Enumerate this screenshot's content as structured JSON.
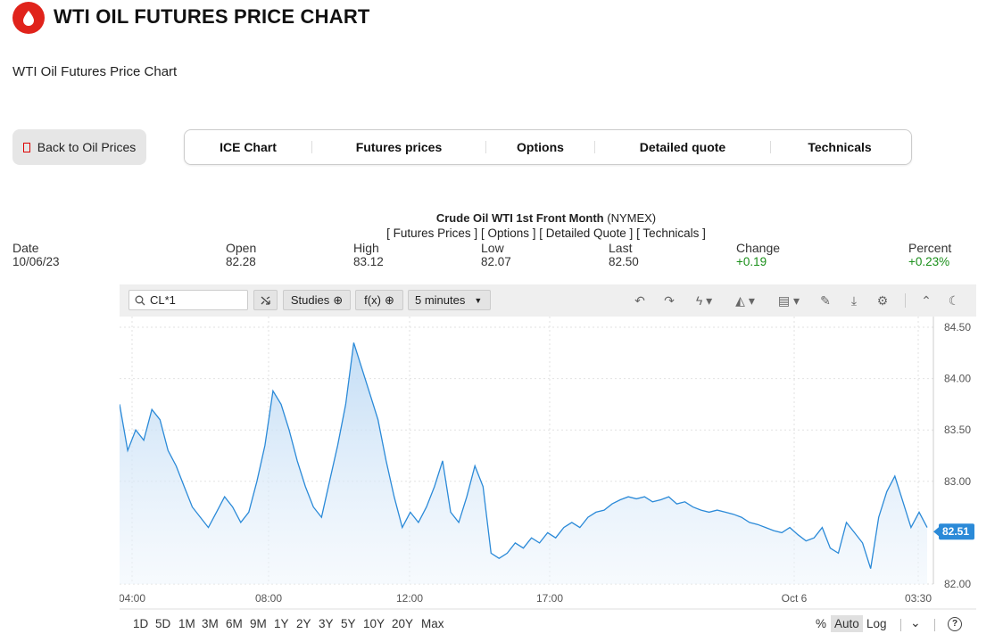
{
  "header": {
    "title": "WTI OIL FUTURES PRICE CHART",
    "subtitle": "WTI Oil Futures Price Chart",
    "logo_icon": "oil-drop-icon",
    "brand_color": "#e0231b"
  },
  "back_button": {
    "label": "Back to Oil Prices"
  },
  "tabs": [
    {
      "label": "ICE Chart"
    },
    {
      "label": "Futures prices"
    },
    {
      "label": "Options"
    },
    {
      "label": "Detailed quote"
    },
    {
      "label": "Technicals"
    }
  ],
  "quote": {
    "instrument": "Crude Oil WTI 1st Front Month",
    "exchange": "(NYMEX)",
    "links": [
      "[ Futures Prices ]",
      "[ Options ]",
      "[ Detailed Quote ]",
      "[ Technicals ]"
    ],
    "columns": [
      {
        "label": "Date",
        "value": "10/06/23"
      },
      {
        "label": "Open",
        "value": "82.28"
      },
      {
        "label": "High",
        "value": "83.12"
      },
      {
        "label": "Low",
        "value": "82.07"
      },
      {
        "label": "Last",
        "value": "82.50"
      },
      {
        "label": "Change",
        "value": "+0.19"
      },
      {
        "label": "Percent",
        "value": "+0.23%"
      }
    ]
  },
  "toolbar": {
    "symbol": "CL*1",
    "studies_label": "Studies",
    "fx_label": "f(x)",
    "interval_label": "5 minutes",
    "icons": [
      "undo-icon",
      "redo-icon",
      "lightning-icon",
      "chart-type-icon",
      "layout-icon",
      "pencil-icon",
      "download-icon",
      "gear-icon",
      "collapse-icon",
      "dark-mode-icon"
    ]
  },
  "chart_data": {
    "type": "area",
    "current_price": "82.51",
    "accent_color": "#2b8ad8",
    "ylim": [
      82.0,
      84.5
    ],
    "y_ticks": [
      "84.50",
      "84.00",
      "83.50",
      "83.00",
      "82.00"
    ],
    "x_ticks": [
      "04:00",
      "08:00",
      "12:00",
      "17:00",
      "Oct 6",
      "03:30"
    ],
    "grid": true,
    "values": [
      83.75,
      83.3,
      83.5,
      83.4,
      83.7,
      83.6,
      83.3,
      83.15,
      82.95,
      82.75,
      82.65,
      82.55,
      82.7,
      82.85,
      82.75,
      82.6,
      82.7,
      83.0,
      83.35,
      83.88,
      83.75,
      83.5,
      83.2,
      82.95,
      82.75,
      82.65,
      83.0,
      83.35,
      83.75,
      84.35,
      84.1,
      83.85,
      83.6,
      83.2,
      82.85,
      82.55,
      82.7,
      82.6,
      82.75,
      82.95,
      83.2,
      82.7,
      82.6,
      82.85,
      83.15,
      82.95,
      82.3,
      82.25,
      82.3,
      82.4,
      82.35,
      82.45,
      82.4,
      82.5,
      82.45,
      82.55,
      82.6,
      82.55,
      82.65,
      82.7,
      82.72,
      82.78,
      82.82,
      82.85,
      82.83,
      82.85,
      82.8,
      82.82,
      82.85,
      82.78,
      82.8,
      82.75,
      82.72,
      82.7,
      82.72,
      82.7,
      82.68,
      82.65,
      82.6,
      82.58,
      82.55,
      82.52,
      82.5,
      82.55,
      82.48,
      82.42,
      82.45,
      82.55,
      82.35,
      82.3,
      82.6,
      82.5,
      82.4,
      82.15,
      82.65,
      82.9,
      83.05,
      82.8,
      82.55,
      82.7,
      82.55
    ]
  },
  "range_bar": {
    "ranges": [
      "1D",
      "5D",
      "1M",
      "3M",
      "6M",
      "9M",
      "1Y",
      "2Y",
      "3Y",
      "5Y",
      "10Y",
      "20Y",
      "Max"
    ],
    "scale_options": [
      "%",
      "Auto",
      "Log"
    ]
  }
}
